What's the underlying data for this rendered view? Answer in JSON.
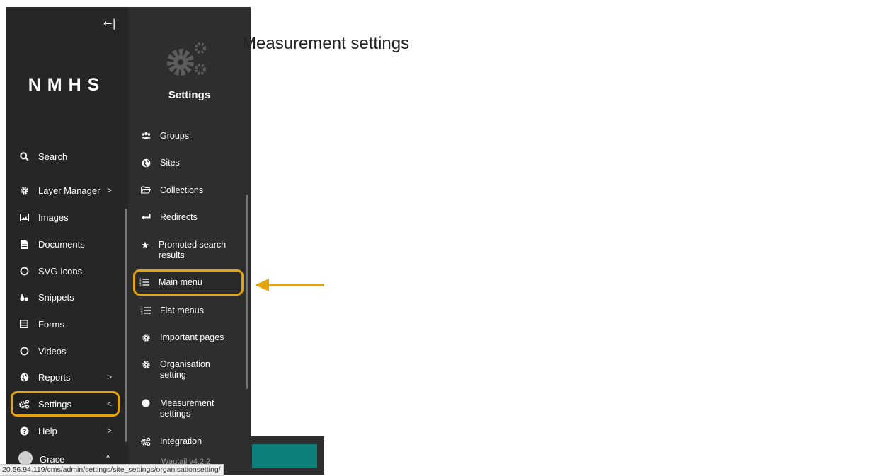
{
  "main": {
    "title": "Measurement settings"
  },
  "sidebar": {
    "collapse_icon": "←|",
    "logo": "NMHS",
    "items": [
      {
        "label": "Search",
        "icon": "search-icon"
      },
      {
        "label": "Layer Manager",
        "icon": "gear-icon",
        "chevron": ">"
      },
      {
        "label": "Images",
        "icon": "image-icon"
      },
      {
        "label": "Documents",
        "icon": "document-icon"
      },
      {
        "label": "SVG Icons",
        "icon": "circle-icon"
      },
      {
        "label": "Snippets",
        "icon": "snippet-icon"
      },
      {
        "label": "Forms",
        "icon": "form-icon"
      },
      {
        "label": "Videos",
        "icon": "circle-icon"
      },
      {
        "label": "Reports",
        "icon": "globe-icon",
        "chevron": ">"
      },
      {
        "label": "Settings",
        "icon": "cogs-icon",
        "chevron": "<",
        "active": true
      },
      {
        "label": "Help",
        "icon": "help-icon",
        "chevron": ">"
      }
    ],
    "user": {
      "name": "Grace",
      "chevron": "^"
    }
  },
  "submenu": {
    "title": "Settings",
    "items": [
      {
        "label": "Groups",
        "icon": "group-icon"
      },
      {
        "label": "Sites",
        "icon": "globe-icon"
      },
      {
        "label": "Collections",
        "icon": "folder-icon"
      },
      {
        "label": "Redirects",
        "icon": "redirect-icon"
      },
      {
        "label": "Promoted search results",
        "icon": "star-icon"
      },
      {
        "label": "Main menu",
        "icon": "list-icon",
        "highlighted": true
      },
      {
        "label": "Flat menus",
        "icon": "list-icon"
      },
      {
        "label": "Important pages",
        "icon": "gear-icon"
      },
      {
        "label": "Organisation setting",
        "icon": "gear-icon"
      },
      {
        "label": "Measurement settings",
        "icon": "dot-icon"
      },
      {
        "label": "Integration",
        "icon": "cogs-icon"
      }
    ],
    "version": "Wagtail v4.2.2"
  },
  "status_bar": {
    "url": "20.56.94.119/cms/admin/settings/site_settings/organisationsetting/"
  },
  "colors": {
    "highlight": "#e5a50a",
    "sidebar_bg": "#262626",
    "submenu_bg": "#2e2e2e",
    "teal": "#0c7f7b"
  }
}
